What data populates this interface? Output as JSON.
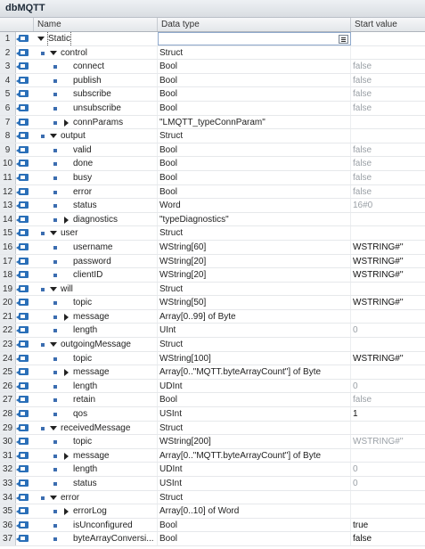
{
  "title": "dbMQTT",
  "columns": {
    "name": "Name",
    "type": "Data type",
    "start": "Start value"
  },
  "rows": [
    {
      "num": "1",
      "name": "Static",
      "type": "",
      "start": "",
      "level": 0,
      "expand": "open",
      "bullet": false
    },
    {
      "num": "2",
      "name": "control",
      "type": "Struct",
      "start": "",
      "level": 1,
      "expand": "open",
      "bullet": true
    },
    {
      "num": "3",
      "name": "connect",
      "type": "Bool",
      "start": "false",
      "level": 2,
      "expand": "none",
      "bullet": true
    },
    {
      "num": "4",
      "name": "publish",
      "type": "Bool",
      "start": "false",
      "level": 2,
      "expand": "none",
      "bullet": true
    },
    {
      "num": "5",
      "name": "subscribe",
      "type": "Bool",
      "start": "false",
      "level": 2,
      "expand": "none",
      "bullet": true
    },
    {
      "num": "6",
      "name": "unsubscribe",
      "type": "Bool",
      "start": "false",
      "level": 2,
      "expand": "none",
      "bullet": true
    },
    {
      "num": "7",
      "name": "connParams",
      "type": "\"LMQTT_typeConnParam\"",
      "start": "",
      "level": 2,
      "expand": "closed",
      "bullet": true
    },
    {
      "num": "8",
      "name": "output",
      "type": "Struct",
      "start": "",
      "level": 1,
      "expand": "open",
      "bullet": true
    },
    {
      "num": "9",
      "name": "valid",
      "type": "Bool",
      "start": "false",
      "level": 2,
      "expand": "none",
      "bullet": true
    },
    {
      "num": "10",
      "name": "done",
      "type": "Bool",
      "start": "false",
      "level": 2,
      "expand": "none",
      "bullet": true
    },
    {
      "num": "11",
      "name": "busy",
      "type": "Bool",
      "start": "false",
      "level": 2,
      "expand": "none",
      "bullet": true
    },
    {
      "num": "12",
      "name": "error",
      "type": "Bool",
      "start": "false",
      "level": 2,
      "expand": "none",
      "bullet": true
    },
    {
      "num": "13",
      "name": "status",
      "type": "Word",
      "start": "16#0",
      "level": 2,
      "expand": "none",
      "bullet": true
    },
    {
      "num": "14",
      "name": "diagnostics",
      "type": "\"typeDiagnostics\"",
      "start": "",
      "level": 2,
      "expand": "closed",
      "bullet": true
    },
    {
      "num": "15",
      "name": "user",
      "type": "Struct",
      "start": "",
      "level": 1,
      "expand": "open",
      "bullet": true
    },
    {
      "num": "16",
      "name": "username",
      "type": "WString[60]",
      "start": "WSTRING#''",
      "level": 2,
      "expand": "none",
      "bullet": true,
      "set": true
    },
    {
      "num": "17",
      "name": "password",
      "type": "WString[20]",
      "start": "WSTRING#''",
      "level": 2,
      "expand": "none",
      "bullet": true,
      "set": true
    },
    {
      "num": "18",
      "name": "clientID",
      "type": "WString[20]",
      "start": "WSTRING#''",
      "level": 2,
      "expand": "none",
      "bullet": true,
      "set": true
    },
    {
      "num": "19",
      "name": "will",
      "type": "Struct",
      "start": "",
      "level": 1,
      "expand": "open",
      "bullet": true
    },
    {
      "num": "20",
      "name": "topic",
      "type": "WString[50]",
      "start": "WSTRING#''",
      "level": 2,
      "expand": "none",
      "bullet": true,
      "set": true
    },
    {
      "num": "21",
      "name": "message",
      "type": "Array[0..99] of Byte",
      "start": "",
      "level": 2,
      "expand": "closed",
      "bullet": true
    },
    {
      "num": "22",
      "name": "length",
      "type": "UInt",
      "start": "0",
      "level": 2,
      "expand": "none",
      "bullet": true
    },
    {
      "num": "23",
      "name": "outgoingMessage",
      "type": "Struct",
      "start": "",
      "level": 1,
      "expand": "open",
      "bullet": true
    },
    {
      "num": "24",
      "name": "topic",
      "type": "WString[100]",
      "start": "WSTRING#''",
      "level": 2,
      "expand": "none",
      "bullet": true,
      "set": true
    },
    {
      "num": "25",
      "name": "message",
      "type": "Array[0..\"MQTT.byteArrayCount\"] of Byte",
      "start": "",
      "level": 2,
      "expand": "closed",
      "bullet": true
    },
    {
      "num": "26",
      "name": "length",
      "type": "UDInt",
      "start": "0",
      "level": 2,
      "expand": "none",
      "bullet": true
    },
    {
      "num": "27",
      "name": "retain",
      "type": "Bool",
      "start": "false",
      "level": 2,
      "expand": "none",
      "bullet": true
    },
    {
      "num": "28",
      "name": "qos",
      "type": "USInt",
      "start": "1",
      "level": 2,
      "expand": "none",
      "bullet": true,
      "set": true
    },
    {
      "num": "29",
      "name": "receivedMessage",
      "type": "Struct",
      "start": "",
      "level": 1,
      "expand": "open",
      "bullet": true
    },
    {
      "num": "30",
      "name": "topic",
      "type": "WString[200]",
      "start": "WSTRING#''",
      "level": 2,
      "expand": "none",
      "bullet": true
    },
    {
      "num": "31",
      "name": "message",
      "type": "Array[0..\"MQTT.byteArrayCount\"] of Byte",
      "start": "",
      "level": 2,
      "expand": "closed",
      "bullet": true
    },
    {
      "num": "32",
      "name": "length",
      "type": "UDInt",
      "start": "0",
      "level": 2,
      "expand": "none",
      "bullet": true
    },
    {
      "num": "33",
      "name": "status",
      "type": "USInt",
      "start": "0",
      "level": 2,
      "expand": "none",
      "bullet": true
    },
    {
      "num": "34",
      "name": "error",
      "type": "Struct",
      "start": "",
      "level": 1,
      "expand": "open",
      "bullet": true
    },
    {
      "num": "35",
      "name": "errorLog",
      "type": "Array[0..10] of Word",
      "start": "",
      "level": 2,
      "expand": "closed",
      "bullet": true
    },
    {
      "num": "36",
      "name": "isUnconfigured",
      "type": "Bool",
      "start": "true",
      "level": 2,
      "expand": "none",
      "bullet": true,
      "set": true
    },
    {
      "num": "37",
      "name": "byteArrayConversi...",
      "type": "Bool",
      "start": "false",
      "level": 2,
      "expand": "none",
      "bullet": true,
      "set": true
    }
  ]
}
